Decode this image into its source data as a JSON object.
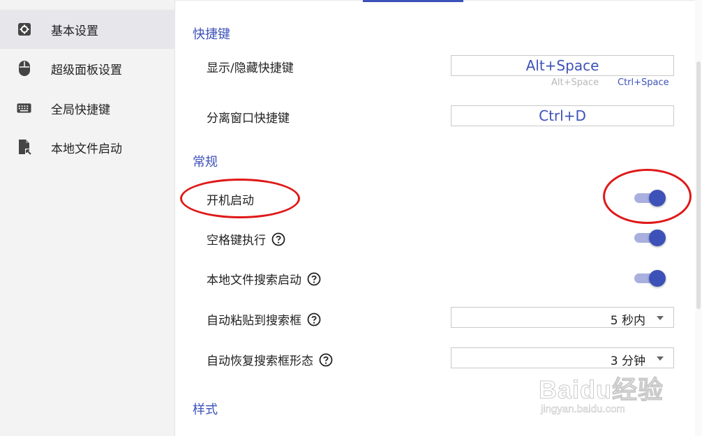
{
  "sidebar": {
    "items": [
      {
        "label": "基本设置",
        "icon": "gear-icon",
        "active": true
      },
      {
        "label": "超级面板设置",
        "icon": "mouse-icon",
        "active": false
      },
      {
        "label": "全局快捷键",
        "icon": "keyboard-icon",
        "active": false
      },
      {
        "label": "本地文件启动",
        "icon": "file-launch-icon",
        "active": false
      }
    ]
  },
  "sections": {
    "hotkeys": {
      "title": "快捷键",
      "show_hide": {
        "label": "显示/隐藏快捷键",
        "value": "Alt+Space",
        "options": [
          "Alt+Space",
          "Ctrl+Space"
        ]
      },
      "detach": {
        "label": "分离窗口快捷键",
        "value": "Ctrl+D"
      }
    },
    "general": {
      "title": "常规",
      "startup": {
        "label": "开机启动",
        "on": true
      },
      "space_exec": {
        "label": "空格键执行",
        "on": true
      },
      "local_search": {
        "label": "本地文件搜索启动",
        "on": true
      },
      "auto_paste": {
        "label": "自动粘贴到搜索框",
        "value": "5 秒内"
      },
      "auto_restore": {
        "label": "自动恢复搜索框形态",
        "value": "3 分钟"
      }
    },
    "style": {
      "title": "样式"
    }
  },
  "watermark": {
    "brand": "Baidu经验",
    "url": "jingyan.baidu.com"
  },
  "colors": {
    "accent": "#3d52b8",
    "toggle_track": "#a9b0e0",
    "annotation": "#e01818",
    "muted_hint": "#b8b8b8"
  }
}
